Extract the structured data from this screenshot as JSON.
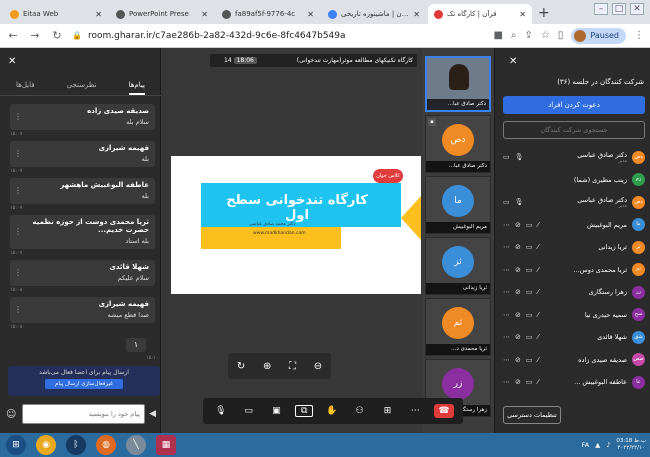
{
  "browser": {
    "tabs": [
      {
        "label": "Eitaa Web",
        "color": "#f29a1e"
      },
      {
        "label": "PowerPoint Prese",
        "color": "#555555"
      },
      {
        "label": "fa89af5f-9776-4c",
        "color": "#555555"
      },
      {
        "label": "قرآن | ماشینوره تاریخی",
        "color": "#3b82f6"
      },
      {
        "label": "قرآن | کارگاه تک",
        "color": "#e03a3a",
        "active": true
      }
    ],
    "url": "room.gharar.ir/c7ae286b-2a82-432d-9c6e-8fc4647b549a",
    "profile_status": "Paused"
  },
  "chat": {
    "tabs": [
      "فایل‌ها",
      "نظرسنجی",
      "پیام‌ها"
    ],
    "messages": [
      {
        "sender": "صدیقه صیدی زاده",
        "text": "سلام بله",
        "time": "۱۵:۰۷"
      },
      {
        "sender": "فهیمه شیرازی",
        "text": "بله",
        "time": "۱۵:۰۷"
      },
      {
        "sender": "عاطفه البوغبیش ماهشهر",
        "text": "بله",
        "time": "۱۵:۰۷"
      },
      {
        "sender": "ثریا محمدی دوست از حوزه نظمیه حضرت خدیم...",
        "text": "بله استاد",
        "time": "۱۵:۰۷"
      },
      {
        "sender": "شهلا قائدی",
        "text": "سلام علیکم",
        "time": "۱۵:۰۸"
      },
      {
        "sender": "فهیمه شیرازی",
        "text": "صدا قطع میشه",
        "time": "۱۵:۰۸"
      }
    ],
    "scroll_count": "۱",
    "last_time": "۱۵:۱۰",
    "public_notice": "ارسال پیام برای اعضا فعال می‌باشد",
    "public_button": "غیرفعال‌سازی ارسال پیام",
    "input_placeholder": "پیام خود را بنویسید"
  },
  "meeting": {
    "title": "کارگاه تکنیکهای مطالعه موثر(مهارت تندخوانی)",
    "timer": "18:06",
    "timer_prefix": "14",
    "slide": {
      "title": "کارگاه تندخوانی سطح اول",
      "author": "دکتر محمد صادق عباسی",
      "site": "www.madkhandan.com",
      "logo": "کلاس خوان"
    }
  },
  "videos": [
    {
      "name": "دکتر صادق عبا...",
      "initials": "",
      "color": "#6e7b8b",
      "camera": true
    },
    {
      "name": "دکتر صادق عبا...",
      "initials": "دص",
      "color": "#f08a24"
    },
    {
      "name": "مریم البوغبیش",
      "initials": "ما",
      "color": "#3b8ed8"
    },
    {
      "name": "ثریا زیدانی",
      "initials": "ثز",
      "color": "#3b8ed8"
    },
    {
      "name": "ثریا محمدی د...",
      "initials": "ثم",
      "color": "#f08a24"
    },
    {
      "name": "زهرا رستگاری",
      "initials": "زر",
      "color": "#8b2fa0"
    }
  ],
  "participants": {
    "title": "شرکت کنندگان در جلسه (۳۶)",
    "invite": "دعوت کردن افراد",
    "search_placeholder": "جستجوی شرکت کنندگان",
    "settings": "تنظیمات دسترسی",
    "list": [
      {
        "name": "دکتر صادق عباسی",
        "role": "مدیر",
        "initials": "دص",
        "color": "#f08a24"
      },
      {
        "name": "زینب مطیری (شما)",
        "role": "",
        "initials": "زم",
        "color": "#2e9e4e"
      },
      {
        "name": "دکتر صادق عباسی",
        "role": "مدیر",
        "initials": "دص",
        "color": "#f08a24"
      },
      {
        "name": "مریم البوغبیش",
        "role": "",
        "initials": "ما",
        "color": "#3b8ed8"
      },
      {
        "name": "ثریا زیدانی",
        "role": "",
        "initials": "ثز",
        "color": "#f08a24"
      },
      {
        "name": "ثریا محمدی دوس...",
        "role": "",
        "initials": "ثم",
        "color": "#f08a24"
      },
      {
        "name": "زهرا رستگاری",
        "role": "",
        "initials": "زر",
        "color": "#8b2fa0"
      },
      {
        "name": "سمیه حیدری نیا",
        "role": "",
        "initials": "سح",
        "color": "#8b2fa0"
      },
      {
        "name": "شهلا قائدی",
        "role": "",
        "initials": "شق",
        "color": "#3b8ed8"
      },
      {
        "name": "صدیقه صیدی زاده",
        "role": "",
        "initials": "صص",
        "color": "#c84aa8"
      },
      {
        "name": "عاطفه البوغبیش ...",
        "role": "",
        "initials": "عا",
        "color": "#8b2fa0"
      }
    ]
  },
  "taskbar": {
    "lang": "FA",
    "time": "03:18 ب.ظ",
    "date": "۲۰۲۲/۲۲/۱۰"
  }
}
